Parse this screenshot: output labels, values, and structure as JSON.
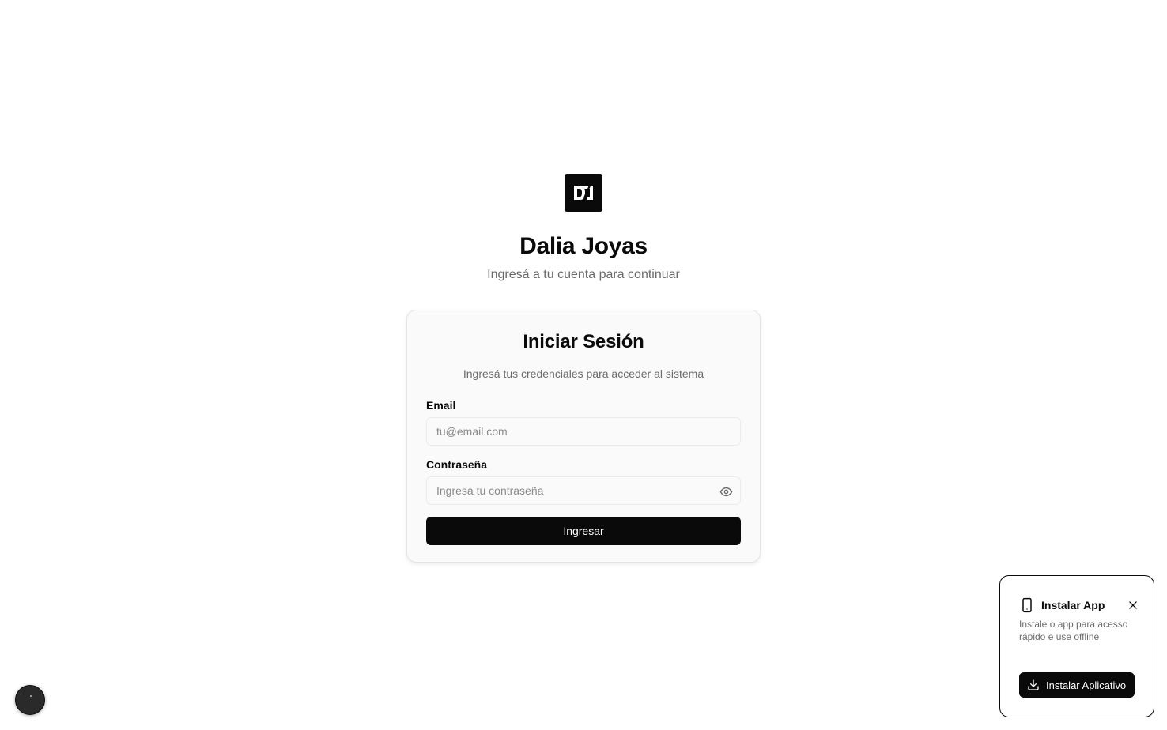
{
  "brand": {
    "title": "Dalia Joyas",
    "subtitle": "Ingresá a tu cuenta para continuar",
    "logo_icon": "dalia-joyas-logo"
  },
  "login": {
    "title": "Iniciar Sesión",
    "description": "Ingresá tus credenciales para acceder al sistema",
    "email_label": "Email",
    "email_placeholder": "tu@email.com",
    "email_value": "",
    "password_label": "Contraseña",
    "password_placeholder": "Ingresá tu contraseña",
    "password_value": "",
    "password_toggle_icon": "eye-icon",
    "submit_label": "Ingresar"
  },
  "install_prompt": {
    "title": "Instalar App",
    "description": "Instale o app para acesso rápido e use offline",
    "button_label": "Instalar Aplicativo",
    "icons": [
      "smartphone-icon",
      "close-icon",
      "download-icon"
    ]
  },
  "colors": {
    "primary": "#0a0a0a",
    "muted_text": "#6b6b6b",
    "card_bg": "#fafafa",
    "border": "#e4e4e4"
  }
}
